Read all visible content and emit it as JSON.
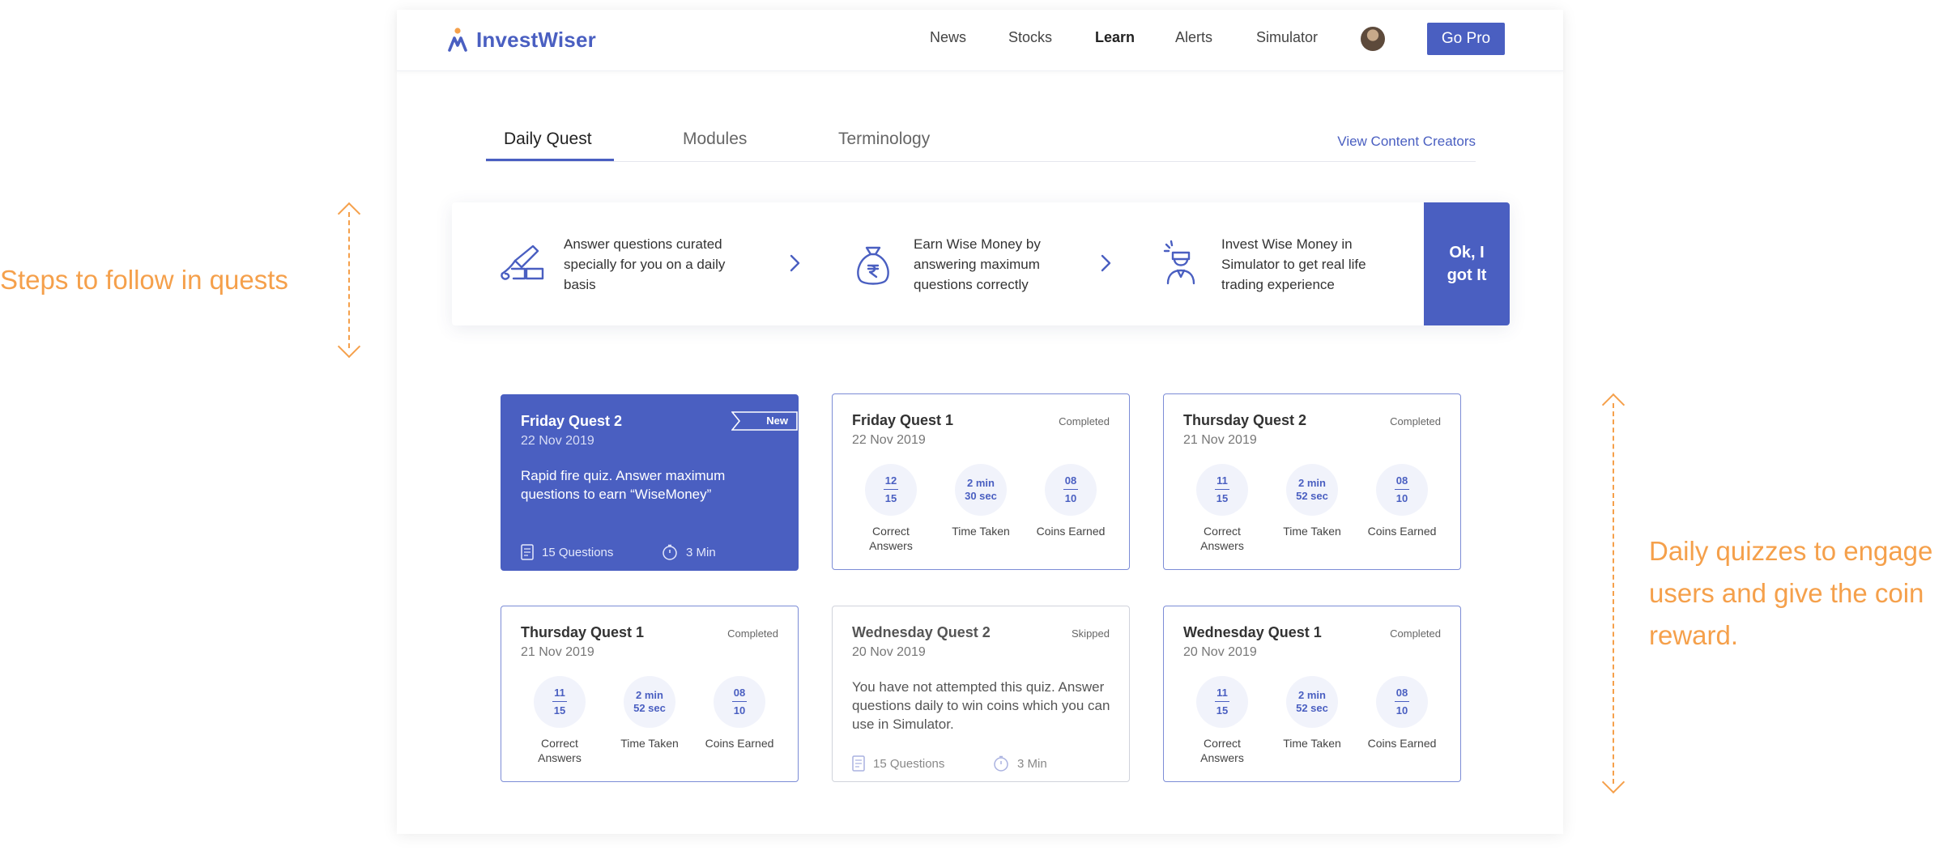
{
  "annotations": {
    "left": "Steps to follow in quests",
    "right": "Daily quizzes to engage users and give the coin reward.",
    "color": "#f5a04b"
  },
  "header": {
    "brand": "InvestWiser",
    "nav": [
      "News",
      "Stocks",
      "Learn",
      "Alerts",
      "Simulator"
    ],
    "active_nav": "Learn",
    "cta": "Go Pro",
    "accent": "#4a5fc1"
  },
  "tabs": {
    "items": [
      "Daily Quest",
      "Modules",
      "Terminology"
    ],
    "active": "Daily Quest",
    "link": "View Content Creators"
  },
  "steps": {
    "items": [
      {
        "icon": "writing-hand-icon",
        "text": "Answer questions curated specially for you on a daily basis"
      },
      {
        "icon": "money-bag-icon",
        "text": "Earn Wise Money by answering maximum questions correctly"
      },
      {
        "icon": "trader-icon",
        "text": "Invest Wise Money in Simulator to get real life trading experience"
      }
    ],
    "button": "Ok, I got It"
  },
  "quests": [
    {
      "title": "Friday Quest 2",
      "date": "22 Nov 2019",
      "badge": "New",
      "description": "Rapid fire quiz. Answer maximum questions to earn “WiseMoney”",
      "questions": "15 Questions",
      "duration": "3 Min"
    },
    {
      "title": "Friday Quest 1",
      "date": "22 Nov 2019",
      "status": "Completed",
      "correct": "12",
      "total": "15",
      "time_a": "2 min",
      "time_b": "30 sec",
      "coins": "08",
      "coins_total": "10",
      "labels": {
        "correct": "Correct Answers",
        "time": "Time Taken",
        "coins": "Coins Earned"
      }
    },
    {
      "title": "Thursday Quest 2",
      "date": "21 Nov 2019",
      "status": "Completed",
      "correct": "11",
      "total": "15",
      "time_a": "2 min",
      "time_b": "52 sec",
      "coins": "08",
      "coins_total": "10",
      "labels": {
        "correct": "Correct Answers",
        "time": "Time Taken",
        "coins": "Coins Earned"
      }
    },
    {
      "title": "Thursday Quest 1",
      "date": "21 Nov 2019",
      "status": "Completed",
      "correct": "11",
      "total": "15",
      "time_a": "2 min",
      "time_b": "52 sec",
      "coins": "08",
      "coins_total": "10",
      "labels": {
        "correct": "Correct Answers",
        "time": "Time Taken",
        "coins": "Coins Earned"
      }
    },
    {
      "title": "Wednesday Quest 2",
      "date": "20 Nov 2019",
      "status": "Skipped",
      "description": "You have not attempted this quiz. Answer questions daily to win coins which you can use in Simulator.",
      "questions": "15 Questions",
      "duration": "3 Min"
    },
    {
      "title": "Wednesday Quest 1",
      "date": "20 Nov 2019",
      "status": "Completed",
      "correct": "11",
      "total": "15",
      "time_a": "2 min",
      "time_b": "52 sec",
      "coins": "08",
      "coins_total": "10",
      "labels": {
        "correct": "Correct Answers",
        "time": "Time Taken",
        "coins": "Coins Earned"
      }
    }
  ]
}
